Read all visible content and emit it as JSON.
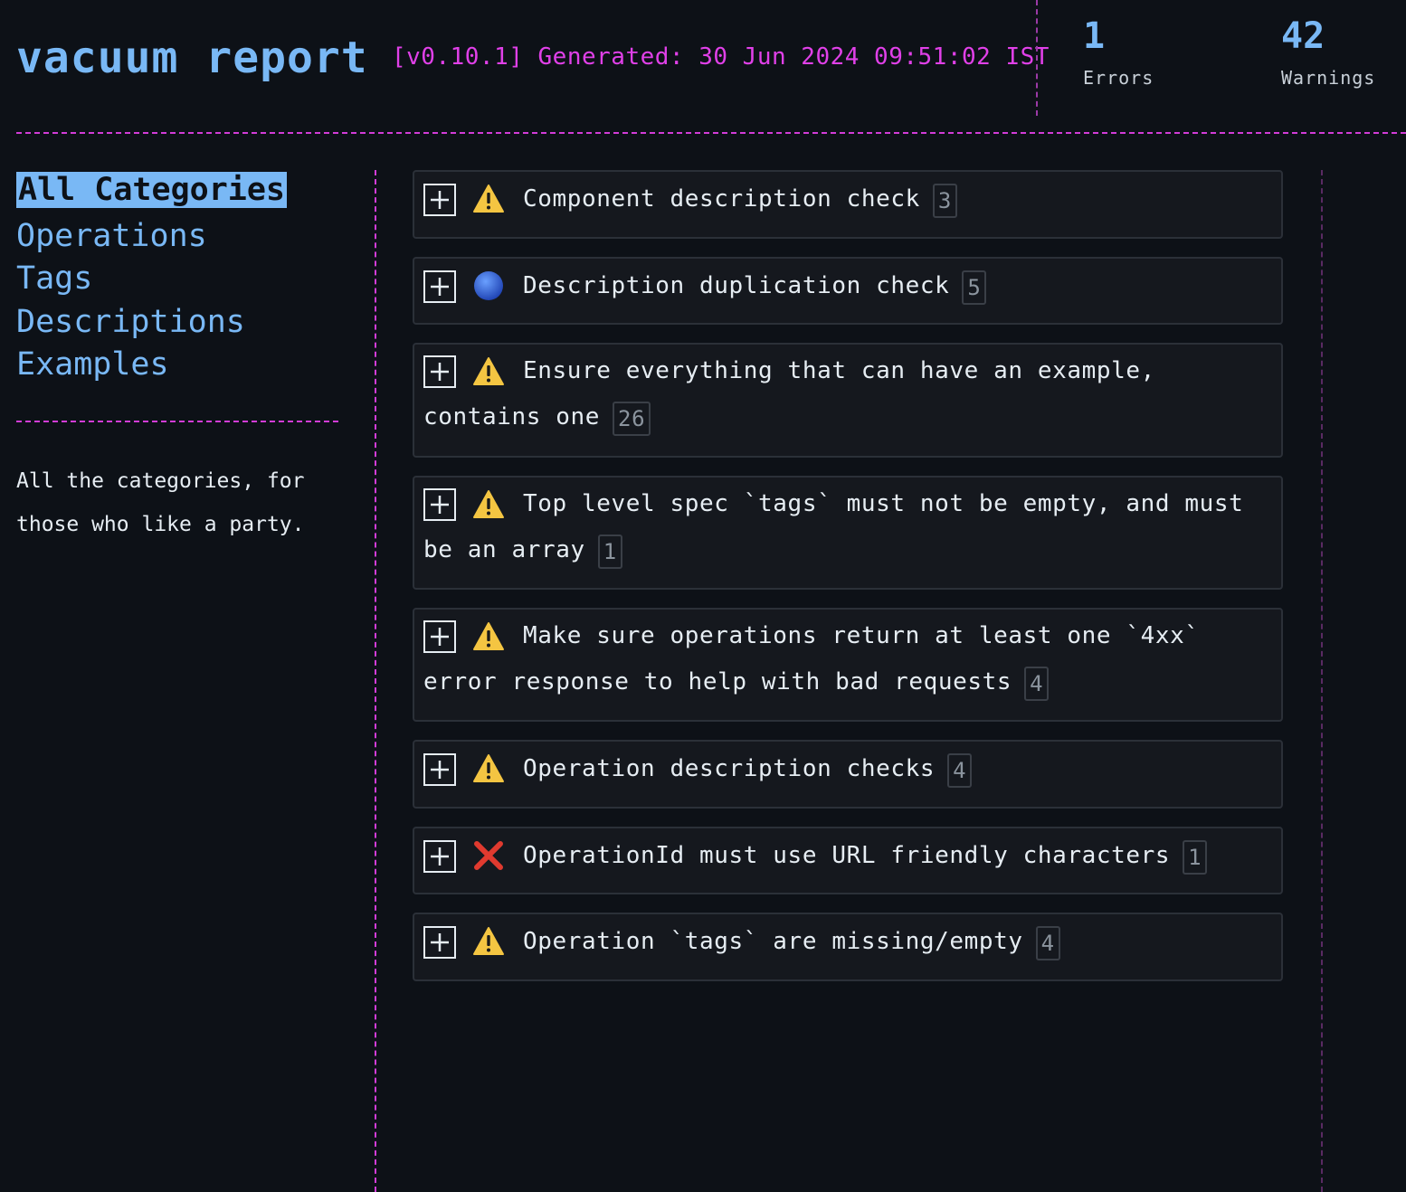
{
  "header": {
    "title": "vacuum report",
    "generated": "[v0.10.1] Generated: 30 Jun 2024 09:51:02 IST",
    "errors": {
      "value": "1",
      "label": "Errors"
    },
    "warnings": {
      "value": "42",
      "label": "Warnings"
    }
  },
  "sidebar": {
    "items": [
      {
        "label": "All Categories",
        "active": true
      },
      {
        "label": "Operations"
      },
      {
        "label": "Tags"
      },
      {
        "label": "Descriptions"
      },
      {
        "label": "Examples"
      }
    ],
    "description": "All the categories, for those who like a party."
  },
  "colors": {
    "accent": "#79b8f5",
    "magenta": "#e040e8",
    "background": "#0d1117",
    "warning": "#f4c542",
    "error": "#e03a2f",
    "info": "#2f6fe0"
  },
  "rules": [
    {
      "severity": "warning",
      "icon": "warning-icon",
      "text": "Component description check",
      "count": "3"
    },
    {
      "severity": "info",
      "icon": "info-circle-icon",
      "text": "Description duplication check",
      "count": "5"
    },
    {
      "severity": "warning",
      "icon": "warning-icon",
      "text": "Ensure everything that can have an example, contains one",
      "count": "26"
    },
    {
      "severity": "warning",
      "icon": "warning-icon",
      "text": "Top level spec `tags` must not be empty, and must be an array",
      "count": "1"
    },
    {
      "severity": "warning",
      "icon": "warning-icon",
      "text": "Make sure operations return at least one `4xx` error response to help with bad requests",
      "count": "4"
    },
    {
      "severity": "warning",
      "icon": "warning-icon",
      "text": "Operation description checks",
      "count": "4"
    },
    {
      "severity": "error",
      "icon": "error-x-icon",
      "text": "OperationId must use URL friendly characters",
      "count": "1"
    },
    {
      "severity": "warning",
      "icon": "warning-icon",
      "text": "Operation `tags` are missing/empty",
      "count": "4"
    }
  ]
}
